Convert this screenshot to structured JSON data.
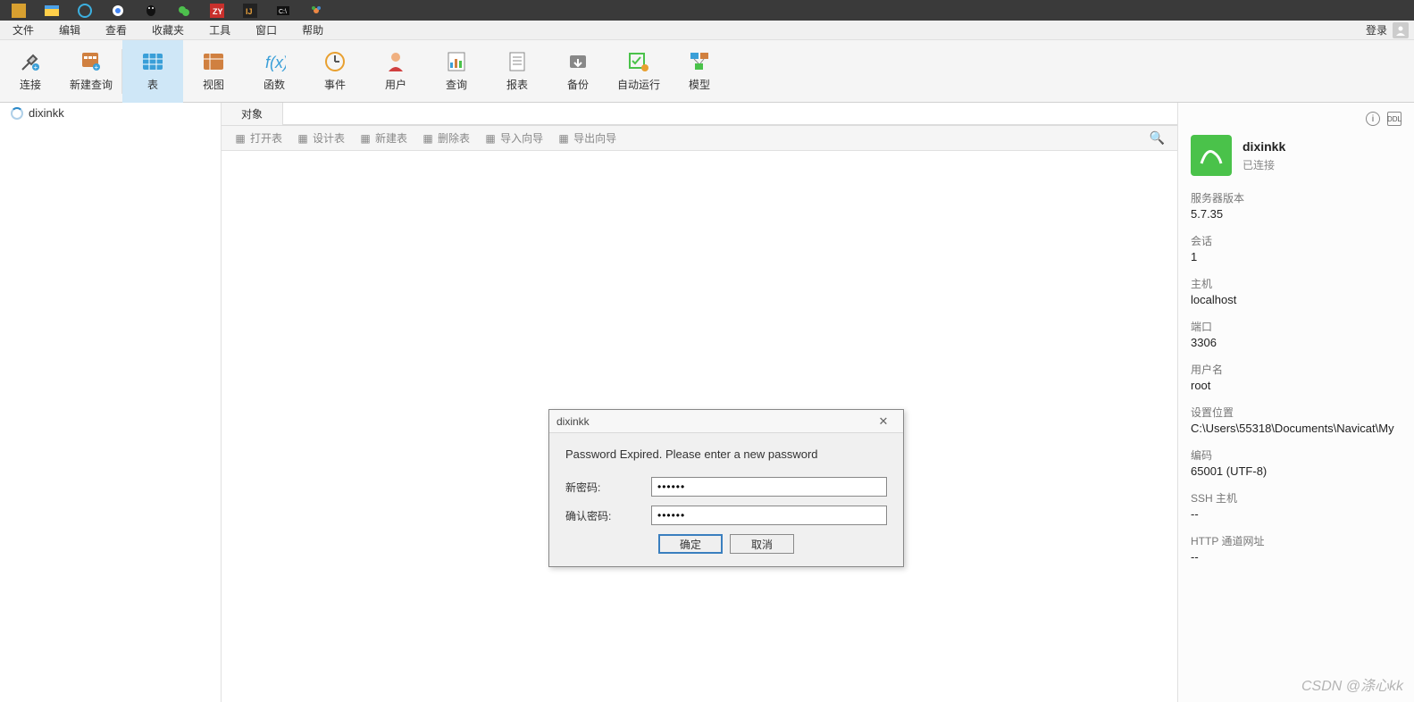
{
  "menubar": {
    "items": [
      "文件",
      "编辑",
      "查看",
      "收藏夹",
      "工具",
      "窗口",
      "帮助"
    ],
    "login_label": "登录"
  },
  "toolbar": {
    "items": [
      {
        "label": "连接"
      },
      {
        "label": "新建查询"
      },
      {
        "label": "表",
        "active": true
      },
      {
        "label": "视图"
      },
      {
        "label": "函数"
      },
      {
        "label": "事件"
      },
      {
        "label": "用户"
      },
      {
        "label": "查询"
      },
      {
        "label": "报表"
      },
      {
        "label": "备份"
      },
      {
        "label": "自动运行"
      },
      {
        "label": "模型"
      }
    ]
  },
  "sidebar": {
    "connection": "dixinkk"
  },
  "tabs": {
    "object": "对象"
  },
  "subtoolbar": {
    "items": [
      "打开表",
      "设计表",
      "新建表",
      "删除表",
      "导入向导",
      "导出向导"
    ]
  },
  "rightpanel": {
    "conn_name": "dixinkk",
    "status": "已连接",
    "info": [
      {
        "label": "服务器版本",
        "value": "5.7.35"
      },
      {
        "label": "会话",
        "value": "1"
      },
      {
        "label": "主机",
        "value": "localhost"
      },
      {
        "label": "端口",
        "value": "3306"
      },
      {
        "label": "用户名",
        "value": "root"
      },
      {
        "label": "设置位置",
        "value": "C:\\Users\\55318\\Documents\\Navicat\\My"
      },
      {
        "label": "编码",
        "value": "65001 (UTF-8)"
      },
      {
        "label": "SSH 主机",
        "value": "--"
      },
      {
        "label": "HTTP 通道网址",
        "value": "--"
      }
    ]
  },
  "dialog": {
    "title": "dixinkk",
    "message": "Password Expired. Please enter a new password",
    "new_pw_label": "新密码:",
    "confirm_pw_label": "确认密码:",
    "new_pw_value": "••••••",
    "confirm_pw_value": "••••••",
    "ok_label": "确定",
    "cancel_label": "取消"
  },
  "watermark": "CSDN @涤心kk"
}
